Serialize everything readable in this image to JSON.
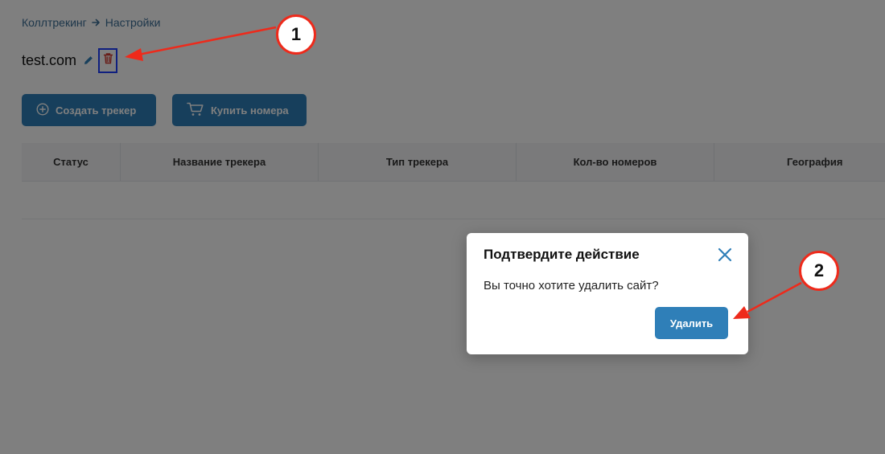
{
  "breadcrumb": {
    "root": "Коллтрекинг",
    "current": "Настройки"
  },
  "site": {
    "title": "test.com"
  },
  "buttons": {
    "create": "Создать трекер",
    "buy": "Купить номера"
  },
  "table": {
    "columns": [
      "Статус",
      "Название трекера",
      "Тип трекера",
      "Кол-во номеров",
      "География"
    ],
    "rows": []
  },
  "modal": {
    "title": "Подтвердите действие",
    "message": "Вы точно хотите удалить сайт?",
    "confirm": "Удалить"
  },
  "annotations": {
    "step1": "1",
    "step2": "2"
  },
  "colors": {
    "accent": "#2f7fb8",
    "annotation": "#ee2a1b",
    "highlight": "#1f3fff",
    "danger": "#d0392f"
  }
}
